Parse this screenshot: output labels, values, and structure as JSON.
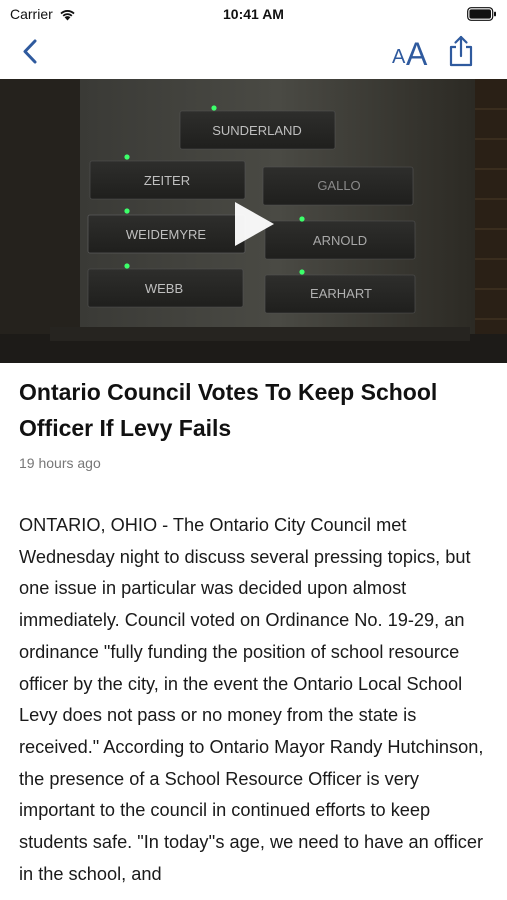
{
  "status_bar": {
    "carrier": "Carrier",
    "time": "10:41 AM",
    "icons": [
      "wifi-icon",
      "battery-icon"
    ]
  },
  "nav": {
    "back_icon": "chevron-left-icon",
    "text_size_label": "AA",
    "share_icon": "share-icon",
    "tint_color": "#2f5a9e"
  },
  "video": {
    "placards": [
      "SUNDERLAND",
      "ZEITER",
      "GALLO",
      "WEIDEMYRE",
      "ARNOLD",
      "WEBB",
      "EARHART"
    ],
    "play_icon": "play-icon"
  },
  "article": {
    "title": "Ontario Council Votes To Keep School Officer If Levy Fails",
    "timestamp": "19 hours ago",
    "body": "ONTARIO, OHIO - The Ontario City Council met Wednesday night to discuss several pressing topics, but one issue in particular was decided upon almost immediately. Council voted on Ordinance No. 19-29, an ordinance \"fully funding the position of school resource officer by the city, in the event the Ontario Local School Levy does not pass or no money from the state is received.\" According to Ontario Mayor Randy Hutchinson, the presence of a School Resource Officer is very important to the council in continued efforts to keep students safe. \"In today''s age, we need to have an officer in the school, and"
  }
}
